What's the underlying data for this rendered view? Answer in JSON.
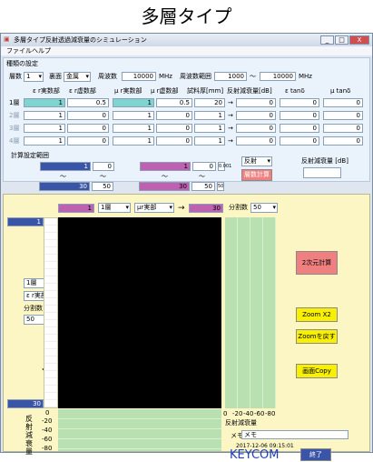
{
  "heading": "多層タイプ",
  "window": {
    "title": "多層タイプ反射透過減衰量のシミュレーション",
    "min": "_",
    "max": "□",
    "close": "X"
  },
  "menu": [
    "ファイル",
    "ヘルプ"
  ],
  "settings": {
    "section": "種類の設定",
    "layers_label": "層数",
    "layers_value": "1",
    "surface_label": "裏面",
    "surface_value": "金属",
    "freq_label": "周波数",
    "freq_value": "10000",
    "freq_unit": "MHz",
    "range_label": "周波数範囲",
    "range_from": "1000",
    "range_sep": "〜",
    "range_to": "10000",
    "range_unit": "MHz"
  },
  "table": {
    "headers": [
      "ε r実数部",
      "ε r虚数部",
      "μ r実数部",
      "μ r虚数部",
      "試料厚[mm]",
      "反射減衰量[dB]",
      "ε tanδ",
      "μ tanδ"
    ],
    "arrow": "→",
    "rows": [
      {
        "label": "1層",
        "v": [
          "1",
          "0.5",
          "1",
          "0.5",
          "20",
          "0",
          "0",
          "0"
        ]
      },
      {
        "label": "2層",
        "v": [
          "1",
          "0",
          "1",
          "0",
          "1",
          "0",
          "0",
          "0"
        ]
      },
      {
        "label": "3層",
        "v": [
          "1",
          "0",
          "1",
          "0",
          "1",
          "0",
          "0",
          "0"
        ]
      },
      {
        "label": "4層",
        "v": [
          "1",
          "0",
          "1",
          "0",
          "1",
          "0",
          "0",
          "0"
        ]
      }
    ]
  },
  "calc_range": {
    "label": "計算設定範囲",
    "row1": [
      "1",
      "0",
      "1",
      "0",
      "0.001"
    ],
    "tilde": "〜",
    "row2": [
      "30",
      "50",
      "30",
      "50",
      "50"
    ],
    "mode_value": "反射",
    "calc_button": "層数計算",
    "result_label": "反射減衰量 [dB]"
  },
  "plot": {
    "top_left": "1",
    "layer_sel": "1層",
    "param_sel": "μr実部",
    "arrow": "→",
    "top_right": "30",
    "div_label": "分割数",
    "div_value": "50",
    "left_top": "1",
    "left_layer_sel": "1層",
    "left_param_sel": "ε r実部",
    "left_div_label": "分割数",
    "left_div_value": "50",
    "down_arrow": "↓",
    "left_bottom": "30",
    "bottom_ticks": [
      "0",
      "-20",
      "-40",
      "-60",
      "-80"
    ],
    "bottom_label": "反射減衰量",
    "left_ticks": [
      "0",
      "-20",
      "-40",
      "-60",
      "-80"
    ],
    "left_label": "反射減衰量"
  },
  "buttons": {
    "calc2": "2次元計算",
    "zoom": "Zoom X2",
    "unzoom": "Zoomを戻す",
    "copy": "画面Copy",
    "exit": "終了"
  },
  "memo": {
    "label": "メモ",
    "value": "メモ"
  },
  "timestamp": "2017-12-06 09:15:01",
  "brand": "KEYCOM",
  "colors": {
    "cyan": "#7fd4d0",
    "blue": "#3a55a8",
    "pink": "#c060b0",
    "calc_button": "#f08080",
    "yellow": "#f8f000",
    "brand": "#2040c0"
  }
}
